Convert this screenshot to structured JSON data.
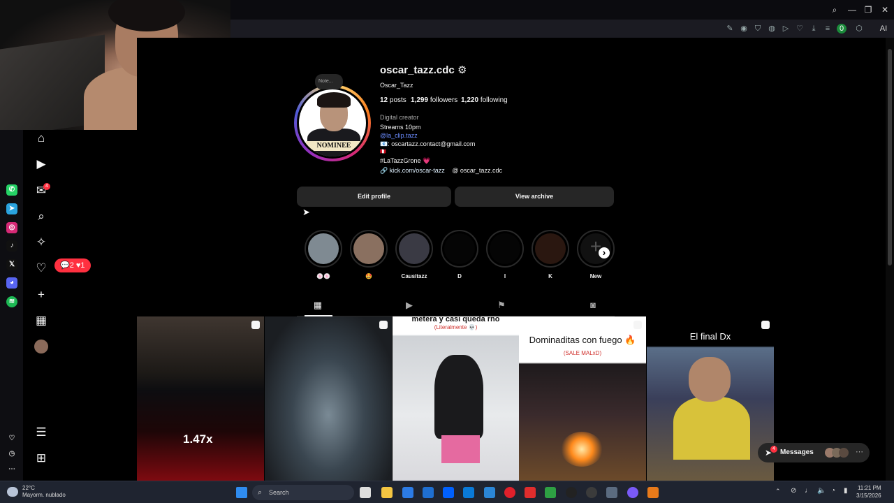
{
  "profile": {
    "username": "oscar_tazz.cdc",
    "full_name": "Oscar_Tazz",
    "posts_count": "12",
    "posts_label": "posts",
    "followers_count": "1,299",
    "followers_label": "followers",
    "following_count": "1,220",
    "following_label": "following",
    "category": "Digital creator",
    "bio_line1": "Streams 10pm",
    "bio_mention": "@la_clip.tazz",
    "bio_email": "📧: oscartazz.contact@gmail.com",
    "bio_flag": "🇵🇪",
    "bio_hashtag": "#LaTazzGrone 💗",
    "link_text": "kick.com/oscar-tazz",
    "threads_text": "oscar_tazz.cdc",
    "note_placeholder": "Note...",
    "avatar_plate": "NOMINEE"
  },
  "buttons": {
    "edit_profile": "Edit profile",
    "view_archive": "View archive"
  },
  "highlights": [
    {
      "label": "🍥🍥",
      "color": "#7f8a92"
    },
    {
      "label": "🤩",
      "color": "#8a7060"
    },
    {
      "label": "Causitazz",
      "color": "#3a3a44"
    },
    {
      "label": "D",
      "color": "#050505"
    },
    {
      "label": "I",
      "color": "#050505"
    },
    {
      "label": "K",
      "color": "#2a1710"
    },
    {
      "label": "New",
      "color": "#111111"
    }
  ],
  "posts": {
    "p1_multiplier": "1.47x",
    "p3_caption": "metera y casi queda rno",
    "p3_sub": "(Literalmente 💀)",
    "p4_caption": "Dominaditas con fuego 🔥",
    "p4_sub": "(SALE MALxD)",
    "p5_caption": "El final Dx"
  },
  "nav": {
    "notifications_badge": "4",
    "activity_comments": "💬2",
    "activity_likes": "♥1"
  },
  "messages": {
    "label": "Messages",
    "badge": "4"
  },
  "taskbar": {
    "weather_temp": "22°C",
    "weather_desc": "Mayorm. nublado",
    "search_placeholder": "Search",
    "time": "11:21 PM",
    "date": "3/15/2026"
  },
  "browser": {
    "ai_label": "AI",
    "extension_count": "0"
  },
  "colors": {
    "accent_red": "#ff3040",
    "link_blue": "#6b8cff",
    "button_gray": "#262626"
  }
}
